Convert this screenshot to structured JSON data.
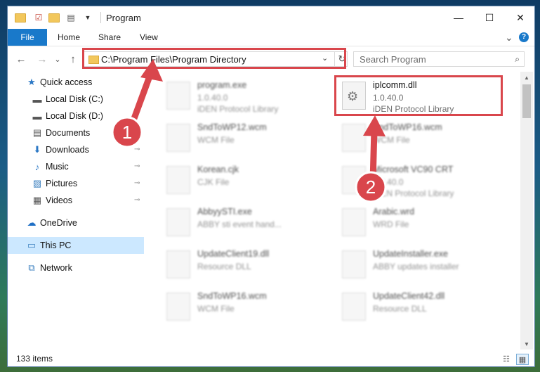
{
  "window": {
    "title": "Program",
    "controls": {
      "minimize": "—",
      "maximize": "☐",
      "close": "✕"
    }
  },
  "ribbon": {
    "tabs": [
      "File",
      "Home",
      "Share",
      "View"
    ],
    "collapse": "⌄",
    "help": "?"
  },
  "address": {
    "back": "←",
    "forward": "→",
    "recent": "⌄",
    "up": "↑",
    "path": "C:\\Program Files\\Program Directory",
    "dropdown": "⌄",
    "refresh": "↻"
  },
  "search": {
    "placeholder": "Search Program",
    "icon": "⌕"
  },
  "sidebar": {
    "items": [
      {
        "label": "Quick access",
        "icon": "star-icon",
        "glyph": "★",
        "pinned": false
      },
      {
        "label": "Local Disk (C:)",
        "icon": "drive-icon",
        "glyph": "▬",
        "pinned": false
      },
      {
        "label": "Local Disk (D:)",
        "icon": "drive-icon",
        "glyph": "▬",
        "pinned": false
      },
      {
        "label": "Documents",
        "icon": "documents-icon",
        "glyph": "▤",
        "pinned": true
      },
      {
        "label": "Downloads",
        "icon": "download-icon",
        "glyph": "⬇",
        "pinned": true
      },
      {
        "label": "Music",
        "icon": "music-icon",
        "glyph": "♪",
        "pinned": true
      },
      {
        "label": "Pictures",
        "icon": "pictures-icon",
        "glyph": "▨",
        "pinned": true
      },
      {
        "label": "Videos",
        "icon": "videos-icon",
        "glyph": "▦",
        "pinned": true
      },
      {
        "label": "OneDrive",
        "icon": "cloud-icon",
        "glyph": "☁",
        "pinned": false
      },
      {
        "label": "This PC",
        "icon": "computer-icon",
        "glyph": "▭",
        "pinned": false
      },
      {
        "label": "Network",
        "icon": "network-icon",
        "glyph": "⧉",
        "pinned": false
      }
    ],
    "pin_glyph": "📌"
  },
  "files": [
    {
      "name": "program.exe",
      "line1": "1.0.40.0",
      "line2": "iDEN Protocol Library",
      "highlighted": false
    },
    {
      "name": "iplcomm.dll",
      "line1": "1.0.40.0",
      "line2": "iDEN Protocol Library",
      "highlighted": true
    },
    {
      "name": "SndToWP12.wcm",
      "line1": "WCM File",
      "line2": "",
      "highlighted": false
    },
    {
      "name": "SndToWP16.wcm",
      "line1": "WCM File",
      "line2": "",
      "highlighted": false
    },
    {
      "name": "Korean.cjk",
      "line1": "CJK File",
      "line2": "",
      "highlighted": false
    },
    {
      "name": "Microsoft VC90 CRT",
      "line1": "1.0.40.0",
      "line2": "iDEN Protocol Library",
      "highlighted": false
    },
    {
      "name": "AbbyySTI.exe",
      "line1": "ABBY sti event hand...",
      "line2": "",
      "highlighted": false
    },
    {
      "name": "Arabic.wrd",
      "line1": "WRD File",
      "line2": "",
      "highlighted": false
    },
    {
      "name": "UpdateClient19.dll",
      "line1": "Resource DLL",
      "line2": "",
      "highlighted": false
    },
    {
      "name": "UpdateInstaller.exe",
      "line1": "ABBY updates installer",
      "line2": "",
      "highlighted": false
    },
    {
      "name": "SndToWP16.wcm",
      "line1": "WCM File",
      "line2": "",
      "highlighted": false
    },
    {
      "name": "UpdateClient42.dll",
      "line1": "Resource DLL",
      "line2": "",
      "highlighted": false
    }
  ],
  "status": {
    "item_count": "133 items"
  },
  "annotations": {
    "step1": "1",
    "step2": "2",
    "accent": "#d9464c"
  }
}
